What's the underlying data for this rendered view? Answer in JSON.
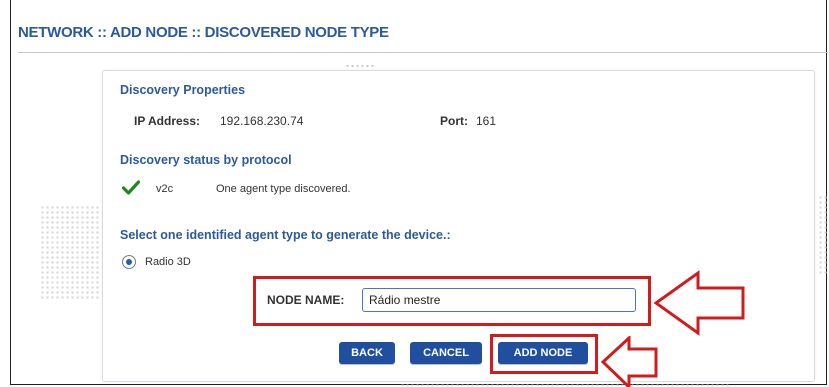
{
  "breadcrumb": {
    "title": "NETWORK :: ADD NODE :: DISCOVERED NODE TYPE"
  },
  "discovery_properties": {
    "heading": "Discovery Properties",
    "ip_label": "IP Address:",
    "ip_value": "192.168.230.74",
    "port_label": "Port:",
    "port_value": "161"
  },
  "discovery_status": {
    "heading": "Discovery status by protocol",
    "rows": [
      {
        "status_icon": "check-icon",
        "protocol": "v2c",
        "message": "One agent type discovered."
      }
    ]
  },
  "agent_selection": {
    "heading": "Select one identified agent type to generate the device.:",
    "options": [
      {
        "label": "Radio 3D",
        "selected": true
      }
    ]
  },
  "node_name": {
    "label": "NODE NAME:",
    "value": "Rádio mestre"
  },
  "buttons": {
    "back": "BACK",
    "cancel": "CANCEL",
    "add_node": "ADD NODE"
  },
  "colors": {
    "title_blue": "#2c5a9c",
    "button_blue": "#1f4f9e",
    "check_green": "#1e8a1e",
    "highlight_red": "#d01c1c"
  }
}
